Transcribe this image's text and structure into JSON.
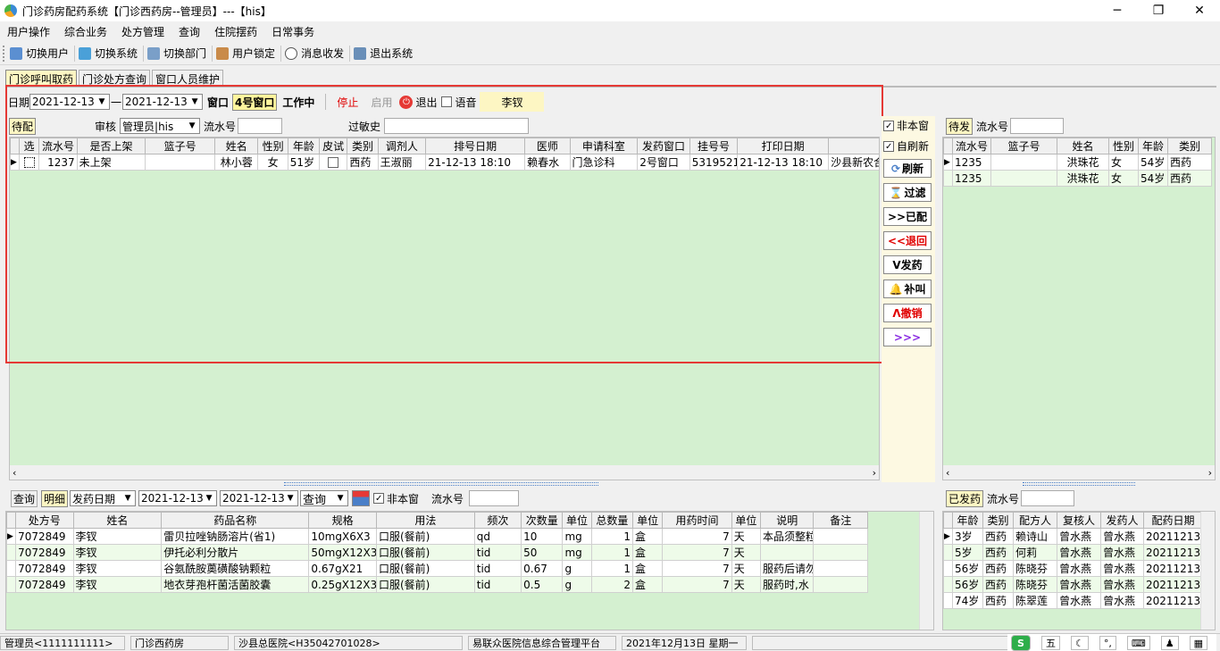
{
  "window": {
    "title": "门诊药房配药系统【门诊西药房--管理员】---【his】"
  },
  "menu": [
    "用户操作",
    "综合业务",
    "处方管理",
    "查询",
    "住院摆药",
    "日常事务"
  ],
  "toolbar": [
    {
      "label": "切换用户",
      "icon": "users-icon"
    },
    {
      "label": "切换系统",
      "icon": "switch-icon"
    },
    {
      "label": "切换部门",
      "icon": "dept-icon"
    },
    {
      "label": "用户锁定",
      "icon": "lock-user-icon"
    },
    {
      "label": "消息收发",
      "icon": "info-icon"
    },
    {
      "label": "退出系统",
      "icon": "exit-icon"
    }
  ],
  "tabs": [
    "门诊呼叫取药",
    "门诊处方查询",
    "窗口人员维护"
  ],
  "top": {
    "date_label": "日期",
    "date_from": "2021-12-13",
    "date_sep": "一",
    "date_to": "2021-12-13",
    "window_label": "窗口",
    "window_value": "4号窗口",
    "status": "工作中",
    "stop": "停止",
    "start": "启用",
    "exit": "退出",
    "voice": "语音",
    "user": "李钗"
  },
  "pending": {
    "tab": "待配",
    "audit_label": "审核",
    "audit_value": "管理员|his",
    "serial_label": "流水号",
    "allergy_label": "过敏史",
    "columns": [
      "选",
      "流水号",
      "是否上架",
      "篮子号",
      "姓名",
      "性别",
      "年龄",
      "皮试",
      "类别",
      "调剂人",
      "排号日期",
      "医师",
      "申请科室",
      "发药窗口",
      "挂号号",
      "打印日期",
      ""
    ],
    "rows": [
      [
        "",
        "1237",
        "未上架",
        "",
        "林小蓉",
        "女",
        "51岁",
        "",
        "西药",
        "王淑丽",
        "21-12-13 18:10",
        "赖春水",
        "门急诊科",
        "2号窗口",
        "5319521",
        "21-12-13 18:10",
        "沙县新农合"
      ]
    ]
  },
  "side_checks": {
    "not_window": "非本窗",
    "auto_refresh": "自刷新"
  },
  "side_buttons": [
    {
      "label": "刷新",
      "color": "#000"
    },
    {
      "label": "过滤",
      "color": "#000"
    },
    {
      "label": ">>已配",
      "color": "#000"
    },
    {
      "label": "<<退回",
      "color": "#e00000"
    },
    {
      "label": "V发药",
      "color": "#000"
    },
    {
      "label": "补叫",
      "color": "#000"
    },
    {
      "label": "Λ撤销",
      "color": "#e00000"
    },
    {
      "label": ">>>",
      "color": "#8a2be2"
    }
  ],
  "waiting": {
    "tab": "待发",
    "serial_label": "流水号",
    "columns": [
      "流水号",
      "篮子号",
      "姓名",
      "性别",
      "年龄",
      "类别"
    ],
    "rows": [
      [
        "1235",
        "",
        "洪珠花",
        "女",
        "54岁",
        "西药"
      ],
      [
        "1235",
        "",
        "洪珠花",
        "女",
        "54岁",
        "西药"
      ]
    ]
  },
  "detail": {
    "query_tab": "查询",
    "detail_tab": "明细",
    "date_type": "发药日期",
    "date_from": "2021-12-13",
    "date_to": "2021-12-13",
    "query_btn": "查询",
    "not_window": "非本窗",
    "serial_label": "流水号",
    "columns": [
      "处方号",
      "姓名",
      "药品名称",
      "规格",
      "用法",
      "频次",
      "次数量",
      "单位",
      "总数量",
      "单位",
      "用药时间",
      "单位",
      "说明",
      "备注"
    ],
    "rows": [
      [
        "7072849",
        "李钗",
        "雷贝拉唑钠肠溶片(省1)",
        "10mgX6X3",
        "口服(餐前)",
        "qd",
        "10",
        "mg",
        "1",
        "盒",
        "7",
        "天",
        "本品须整粒",
        ""
      ],
      [
        "7072849",
        "李钗",
        "伊托必利分散片",
        "50mgX12X3",
        "口服(餐前)",
        "tid",
        "50",
        "mg",
        "1",
        "盒",
        "7",
        "天",
        "",
        ""
      ],
      [
        "7072849",
        "李钗",
        "谷氨酰胺薁磺酸钠颗粒",
        "0.67gX21",
        "口服(餐前)",
        "tid",
        "0.67",
        "g",
        "1",
        "盒",
        "7",
        "天",
        "服药后请勿",
        ""
      ],
      [
        "7072849",
        "李钗",
        "地衣芽孢杆菌活菌胶囊",
        "0.25gX12X3",
        "口服(餐前)",
        "tid",
        "0.5",
        "g",
        "2",
        "盒",
        "7",
        "天",
        "服药时,水",
        ""
      ]
    ]
  },
  "dispensed": {
    "tab": "已发药",
    "serial_label": "流水号",
    "columns": [
      "年龄",
      "类别",
      "配方人",
      "复核人",
      "发药人",
      "配药日期"
    ],
    "rows": [
      [
        "3岁",
        "西药",
        "赖诗山",
        "曾水燕",
        "曾水燕",
        "20211213"
      ],
      [
        "5岁",
        "西药",
        "何莉",
        "曾水燕",
        "曾水燕",
        "20211213"
      ],
      [
        "56岁",
        "西药",
        "陈晓芬",
        "曾水燕",
        "曾水燕",
        "20211213"
      ],
      [
        "56岁",
        "西药",
        "陈晓芬",
        "曾水燕",
        "曾水燕",
        "20211213"
      ],
      [
        "74岁",
        "西药",
        "陈翠莲",
        "曾水燕",
        "曾水燕",
        "20211213"
      ]
    ]
  },
  "status": [
    "管理员<1111111111>",
    "门诊西药房",
    "沙县总医院<H35042701028>",
    "易联众医院信息综合管理平台",
    "2021年12月13日 星期一"
  ],
  "ime": {
    "label": "五"
  }
}
